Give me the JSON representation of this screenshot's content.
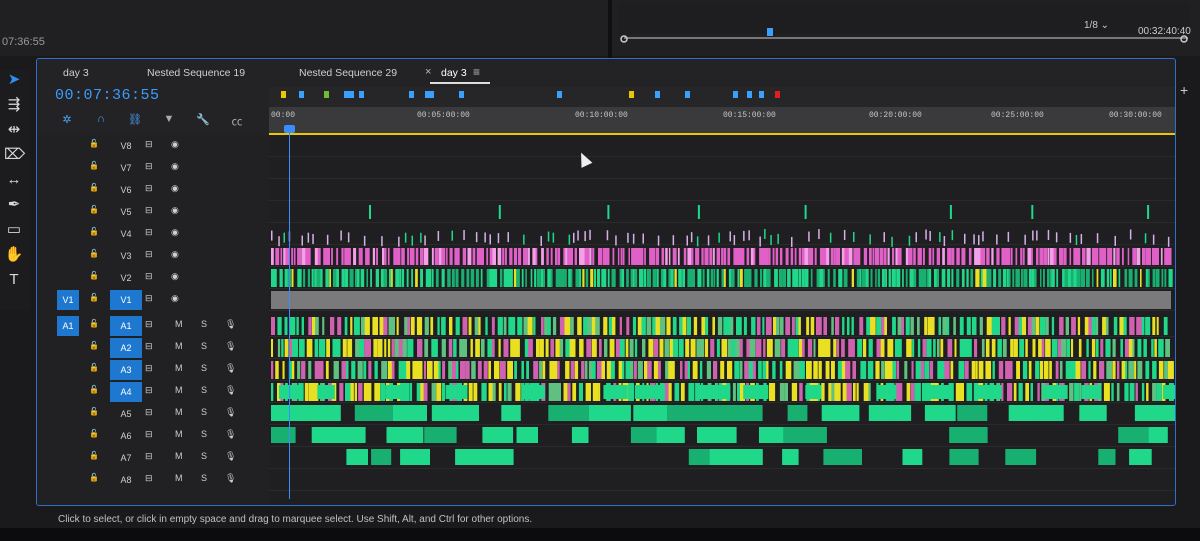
{
  "source_monitor": {
    "timecode": "07:36:55"
  },
  "program_monitor": {
    "resolution": "1/8",
    "timecode": "00:32:40:40",
    "transport": [
      "▾",
      "{",
      "}",
      "⇤",
      "◂",
      "▶",
      "▸",
      "⇥",
      "▭",
      "▭",
      "◙",
      "▭",
      "▭"
    ]
  },
  "tools": [
    "selection-tool",
    "track-select-tool",
    "ripple-edit-tool",
    "razor-tool",
    "slip-tool",
    "pen-tool",
    "rectangle-tool",
    "hand-tool",
    "type-tool"
  ],
  "timeline": {
    "tabs": [
      {
        "label": "day 3"
      },
      {
        "label": "Nested Sequence 19"
      },
      {
        "label": "Nested Sequence 29"
      },
      {
        "label": "day 3",
        "active": true
      }
    ],
    "timecode": "00:07:36:55",
    "ruler_ticks": [
      "00:00",
      "00:05:00:00",
      "00:10:00:00",
      "00:15:00:00",
      "00:20:00:00",
      "00:25:00:00",
      "00:30:00:00"
    ],
    "video_tracks": [
      {
        "name": "V8"
      },
      {
        "name": "V7"
      },
      {
        "name": "V6"
      },
      {
        "name": "V5"
      },
      {
        "name": "V4"
      },
      {
        "name": "V3"
      },
      {
        "name": "V2"
      },
      {
        "name": "V1",
        "source": "V1",
        "targeted": true
      }
    ],
    "audio_tracks": [
      {
        "name": "A1",
        "source": "A1",
        "targeted": true
      },
      {
        "name": "A2",
        "targeted": true
      },
      {
        "name": "A3",
        "targeted": true
      },
      {
        "name": "A4",
        "targeted": true
      },
      {
        "name": "A5"
      },
      {
        "name": "A6"
      },
      {
        "name": "A7"
      },
      {
        "name": "A8"
      }
    ],
    "labels": {
      "mute": "M",
      "solo": "S"
    },
    "colors": {
      "pink": "#e060c8",
      "green": "#1fd88a",
      "yellow": "#e8e020",
      "playhead": "#3a8cff"
    }
  },
  "status_bar": "Click to select, or click in empty space and drag to marquee select. Use Shift, Alt, and Ctrl for other options."
}
